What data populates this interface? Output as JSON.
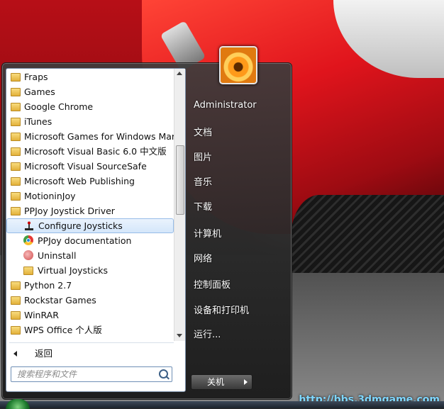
{
  "programs": [
    {
      "label": "Fraps",
      "icon": "folder-icon",
      "level": 0
    },
    {
      "label": "Games",
      "icon": "folder-icon",
      "level": 0
    },
    {
      "label": "Google Chrome",
      "icon": "folder-icon",
      "level": 0
    },
    {
      "label": "iTunes",
      "icon": "folder-icon",
      "level": 0
    },
    {
      "label": "Microsoft Games for Windows Mark",
      "icon": "folder-icon",
      "level": 0
    },
    {
      "label": "Microsoft Visual Basic 6.0 中文版",
      "icon": "folder-icon",
      "level": 0
    },
    {
      "label": "Microsoft Visual SourceSafe",
      "icon": "folder-icon",
      "level": 0
    },
    {
      "label": "Microsoft Web Publishing",
      "icon": "folder-icon",
      "level": 0
    },
    {
      "label": "MotioninJoy",
      "icon": "folder-icon",
      "level": 0
    },
    {
      "label": "PPJoy Joystick Driver",
      "icon": "folder-icon",
      "level": 0
    },
    {
      "label": "Configure Joysticks",
      "icon": "joystick-icon",
      "level": 1,
      "selected": true
    },
    {
      "label": "PPJoy documentation",
      "icon": "chrome-icon",
      "level": 1
    },
    {
      "label": "Uninstall",
      "icon": "uninstall-icon",
      "level": 1
    },
    {
      "label": "Virtual Joysticks",
      "icon": "folder-icon",
      "level": 1
    },
    {
      "label": "Python 2.7",
      "icon": "folder-icon",
      "level": 0
    },
    {
      "label": "Rockstar Games",
      "icon": "folder-icon",
      "level": 0
    },
    {
      "label": "WinRAR",
      "icon": "folder-icon",
      "level": 0
    },
    {
      "label": "WPS Office 个人版",
      "icon": "folder-icon",
      "level": 0
    }
  ],
  "back_label": "返回",
  "search_placeholder": "搜索程序和文件",
  "right_items": [
    {
      "label": "Administrator",
      "name": "right-item-administrator"
    },
    {
      "label": "文档",
      "name": "right-item-documents"
    },
    {
      "label": "图片",
      "name": "right-item-pictures"
    },
    {
      "label": "音乐",
      "name": "right-item-music"
    },
    {
      "label": "下载",
      "name": "right-item-downloads"
    },
    {
      "label": "计算机",
      "name": "right-item-computer"
    },
    {
      "label": "网络",
      "name": "right-item-network"
    },
    {
      "label": "控制面板",
      "name": "right-item-control-panel"
    },
    {
      "label": "设备和打印机",
      "name": "right-item-devices-printers"
    },
    {
      "label": "运行...",
      "name": "right-item-run"
    }
  ],
  "shutdown_label": "关机",
  "watermark": "http://bbs.3dmgame.com"
}
